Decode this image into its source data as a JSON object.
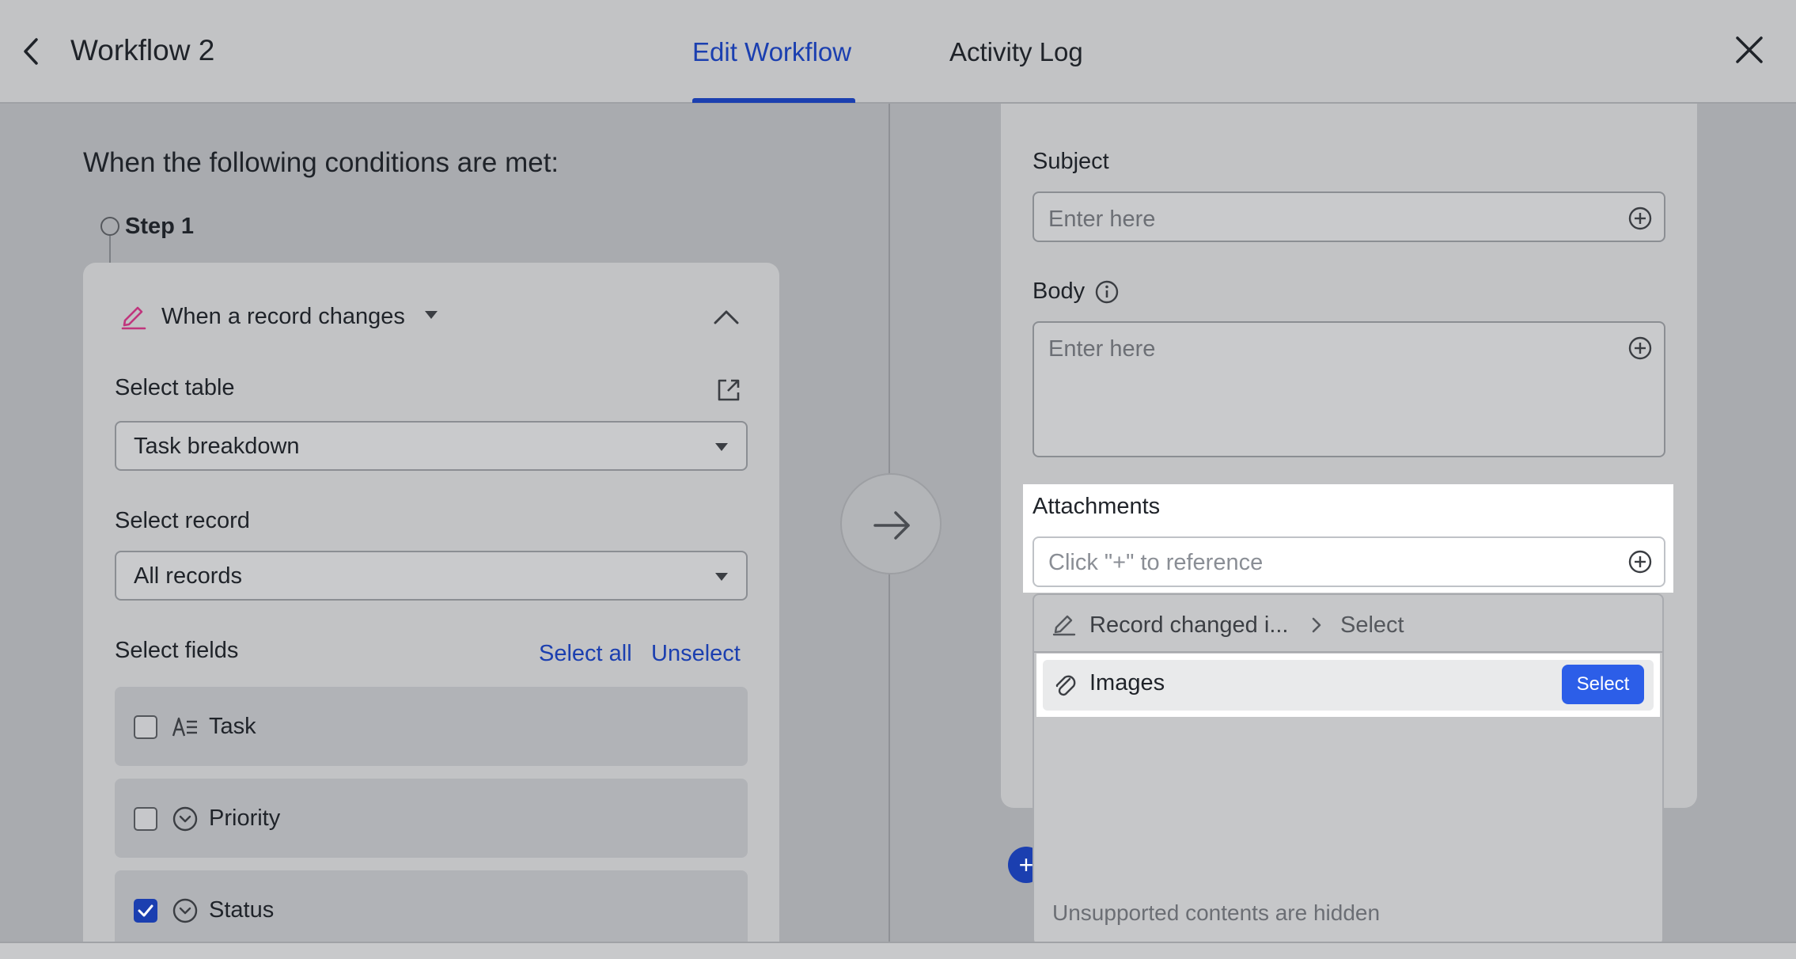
{
  "header": {
    "title": "Workflow 2",
    "tabs": [
      {
        "label": "Edit Workflow",
        "active": true
      },
      {
        "label": "Activity Log",
        "active": false
      }
    ]
  },
  "left": {
    "conditions_title": "When the following conditions are met:",
    "step_label": "Step 1",
    "trigger_label": "When a record changes",
    "select_table_label": "Select table",
    "select_table_value": "Task breakdown",
    "select_record_label": "Select record",
    "select_record_value": "All records",
    "select_fields_label": "Select fields",
    "select_all": "Select all",
    "unselect": "Unselect",
    "fields": [
      {
        "name": "Task",
        "icon": "text-field-icon",
        "checked": false
      },
      {
        "name": "Priority",
        "icon": "single-select-icon",
        "checked": false
      },
      {
        "name": "Status",
        "icon": "single-select-icon",
        "checked": true
      }
    ]
  },
  "right": {
    "subject_label": "Subject",
    "subject_placeholder": "Enter here",
    "body_label": "Body",
    "body_placeholder": "Enter here",
    "attachments_label": "Attachments",
    "attachments_placeholder": "Click \"+\" to reference",
    "dropdown": {
      "crumb": "Record changed i...",
      "crumb_select": "Select",
      "item_label": "Images",
      "item_button": "Select",
      "footer": "Unsupported contents are hidden"
    }
  },
  "colors": {
    "accent": "#1b3fb0",
    "button_blue": "#2c5ee8",
    "trigger_icon": "#c0357d"
  }
}
